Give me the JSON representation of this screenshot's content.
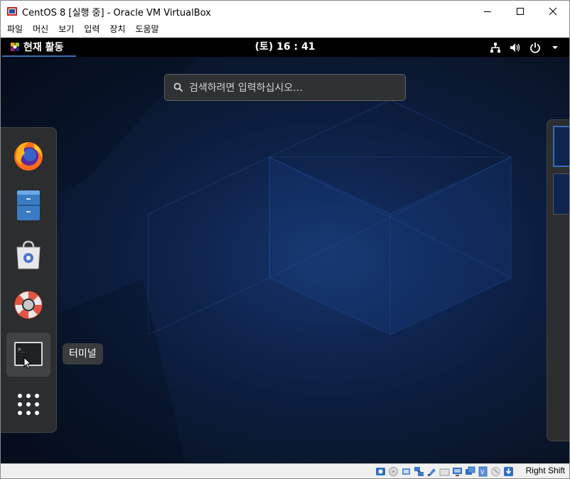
{
  "window": {
    "title": "CentOS 8 [실행 중] - Oracle VM VirtualBox",
    "app_icon": "virtualbox-icon",
    "controls": [
      "minimize-icon",
      "maximize-icon",
      "close-icon"
    ]
  },
  "menu": {
    "items": [
      "파일",
      "머신",
      "보기",
      "입력",
      "장치",
      "도움말"
    ]
  },
  "gnome": {
    "activities_label": "현재 활동",
    "clock": "(토) 16 : 41",
    "tray_icons": [
      "network-wired-icon",
      "volume-icon",
      "power-icon",
      "chevron-down-icon"
    ],
    "search": {
      "placeholder": "검색하려면 입력하십시오…"
    },
    "dash": {
      "apps": [
        "firefox-icon",
        "files-icon",
        "software-icon",
        "help-icon",
        "terminal-icon",
        "show-apps-icon"
      ],
      "tooltip": "터미널"
    }
  },
  "statusbar": {
    "icons": [
      "hard-disk-icon",
      "optical-drive-icon",
      "audio-icon",
      "network-icon",
      "usb-icon",
      "shared-folder-icon",
      "display-icon",
      "video-capture-icon",
      "cpu-icon",
      "mouse-integration-icon",
      "host-key-icon"
    ],
    "host_key": "Right Shift"
  }
}
